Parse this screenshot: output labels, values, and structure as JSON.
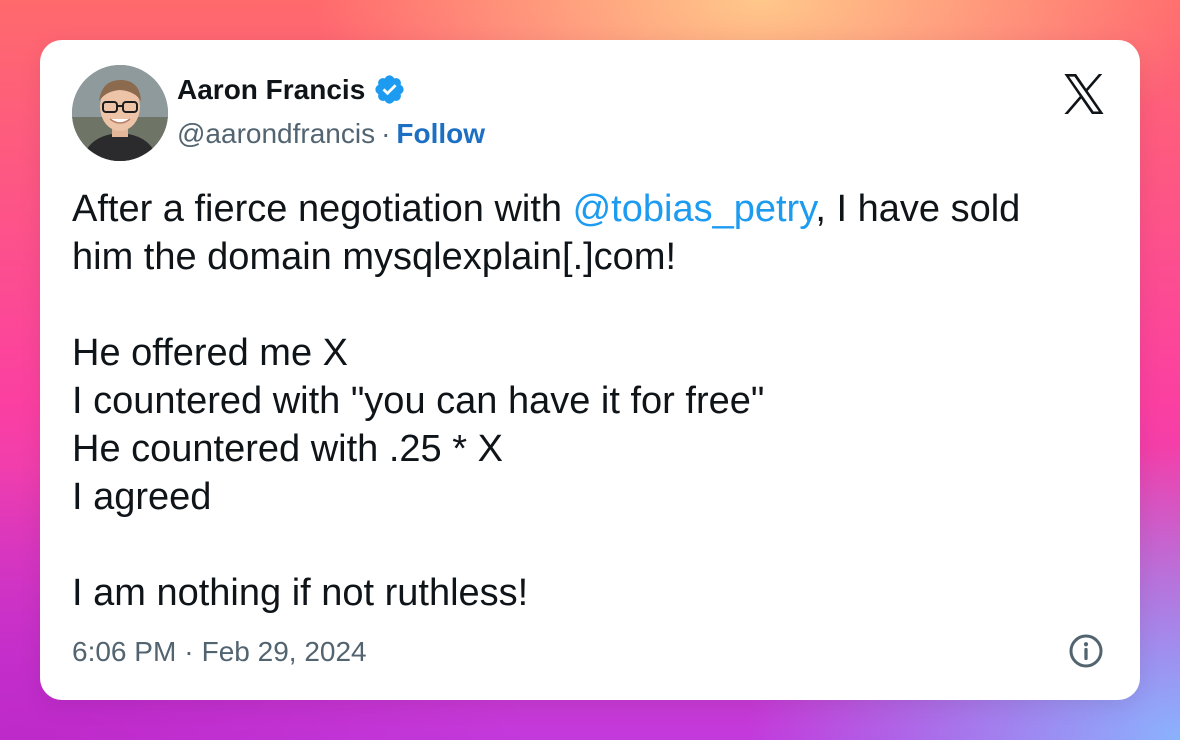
{
  "author": {
    "name": "Aaron Francis",
    "handle": "@aarondfrancis",
    "separator": "·",
    "follow_label": "Follow",
    "avatar_icon": "profile-photo",
    "verified_icon": "verified-badge-icon"
  },
  "brand": {
    "logo_icon": "x-logo-icon"
  },
  "tweet": {
    "line1_before": "After a fierce negotiation with ",
    "mention": "@tobias_petry",
    "line1_after": ", I have sold",
    "line2": "him the domain mysqlexplain[.]com!",
    "line3": "He offered me X",
    "line4": "I countered with \"you can have it for free\"",
    "line5": "He countered with .25 * X",
    "line6": "I agreed",
    "line7": "I am nothing if not ruthless!"
  },
  "footer": {
    "time": "6:06 PM",
    "separator": "·",
    "date": "Feb 29, 2024",
    "info_icon": "info-icon"
  },
  "colors": {
    "link": "#1d9bf0",
    "follow": "#1d6fc4",
    "muted": "#536471",
    "text": "#0f1419"
  }
}
